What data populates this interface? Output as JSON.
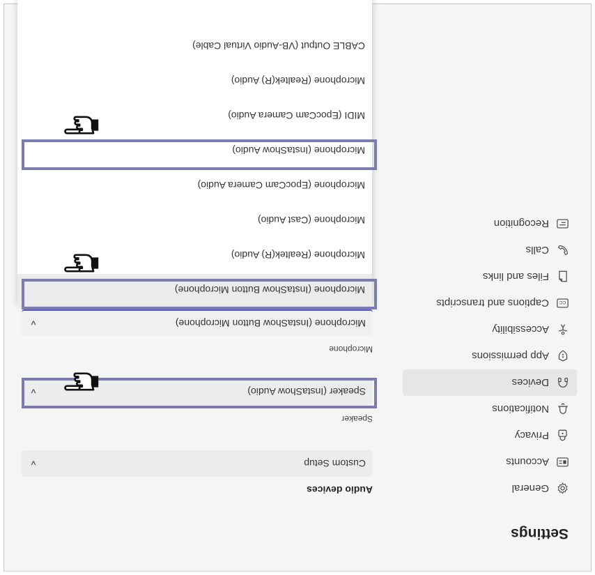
{
  "settings": {
    "title": "Settings"
  },
  "sidebar": {
    "items": [
      {
        "label": "General",
        "icon": "gear-icon"
      },
      {
        "label": "Accounts",
        "icon": "id-card-icon"
      },
      {
        "label": "Privacy",
        "icon": "lock-icon"
      },
      {
        "label": "Notifications",
        "icon": "bell-icon"
      },
      {
        "label": "Devices",
        "icon": "headset-icon",
        "active": true
      },
      {
        "label": "App permissions",
        "icon": "shield-icon"
      },
      {
        "label": "Accessibility",
        "icon": "accessibility-icon"
      },
      {
        "label": "Captions and transcripts",
        "icon": "cc-icon"
      },
      {
        "label": "Files and links",
        "icon": "file-icon"
      },
      {
        "label": "Calls",
        "icon": "phone-icon"
      },
      {
        "label": "Recognition",
        "icon": "recognition-icon"
      }
    ]
  },
  "audio": {
    "section_title": "Audio devices",
    "device_setup": "Custom Setup",
    "speaker_label": "Speaker",
    "speaker_value": "Speaker (InstaShow Audio)",
    "microphone_label": "Microphone",
    "microphone_value": "Microphone (InstaShow Button Microphone)",
    "options": [
      "Microphone (InstaShow Button Microphone)",
      "Microphone (Realtek(R) Audio)",
      "Microphone (Cast Audio)",
      "Microphone (EpocCam Camera Audio)",
      "Microphone (InstaShow Audio)",
      "MIDI (EpocCam Camera Audio)",
      "Microphone (Realtek(R) Audio)",
      "CABLE Output (VB-Audio Virtual Cable)"
    ]
  },
  "colors": {
    "highlight": "#7c7cb0",
    "accent": "#5b5fc7"
  }
}
